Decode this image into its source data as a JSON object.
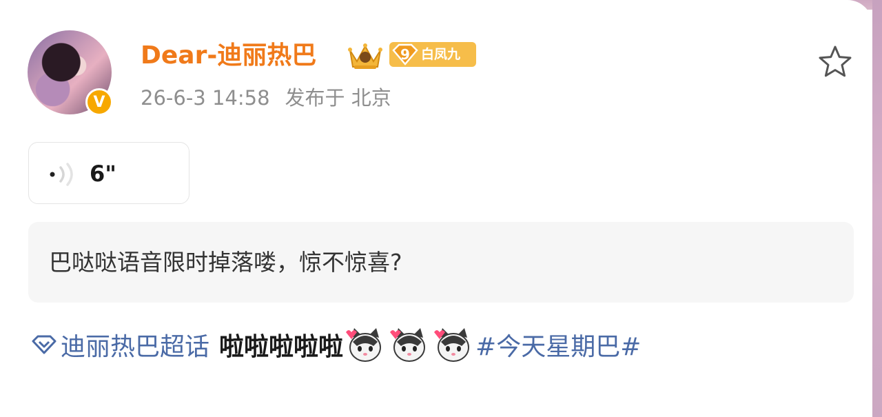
{
  "post": {
    "username": "Dear-迪丽热巴",
    "rank_badge": {
      "number": "9",
      "label": "白凤九"
    },
    "timestamp": "26-6-3 14:58",
    "location": "发布于 北京",
    "voice": {
      "duration": "6\""
    },
    "quote": "巴哒哒语音限时掉落喽，惊不惊喜?",
    "supertopic_link": "迪丽热巴超话",
    "body_text": "啦啦啦啦啦",
    "hashtag": "#今天星期巴#",
    "verified_mark": "V"
  },
  "colors": {
    "username": "#f07a1a",
    "link": "#4a6aa6",
    "badge_gold": "#f6bd4a",
    "verified": "#f7a800",
    "quote_bg": "#f6f6f6"
  },
  "icons": {
    "favorite": "star-icon",
    "voice": "voice-wave-icon",
    "supertopic": "diamond-icon",
    "emoji": "cat-emoji-icon",
    "crown": "crown-icon"
  }
}
